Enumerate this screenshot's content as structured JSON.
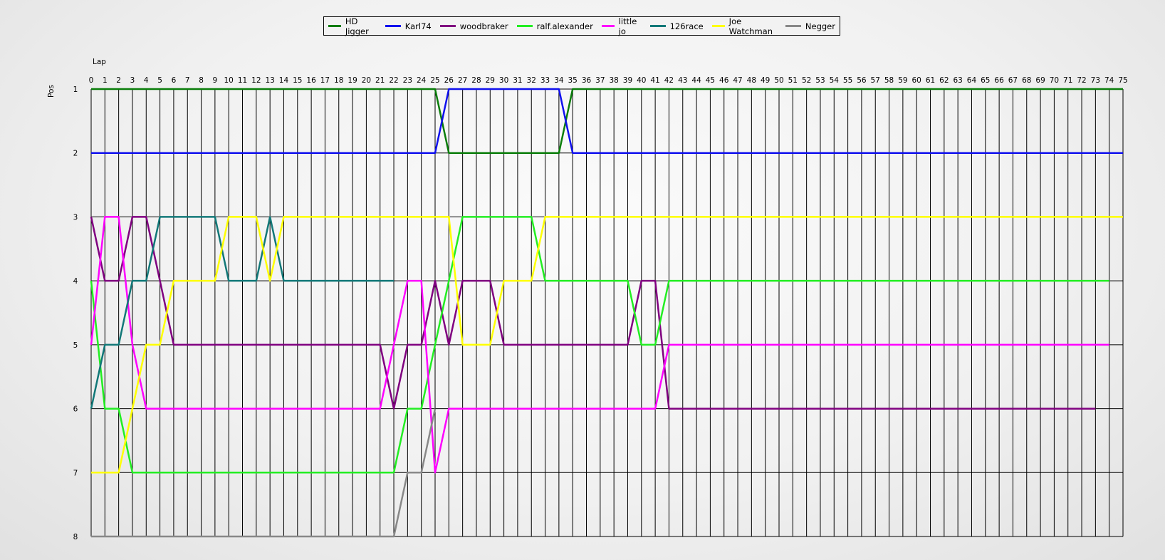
{
  "chart_data": {
    "type": "line",
    "xlabel": "Lap",
    "ylabel": "Pos",
    "xlim": [
      0,
      75
    ],
    "ylim": [
      1,
      8
    ],
    "y_inverted": true,
    "grid": true,
    "legend_position": "top-center",
    "x": [
      0,
      1,
      2,
      3,
      4,
      5,
      6,
      7,
      8,
      9,
      10,
      11,
      12,
      13,
      14,
      15,
      16,
      17,
      18,
      19,
      20,
      21,
      22,
      23,
      24,
      25,
      26,
      27,
      28,
      29,
      30,
      31,
      32,
      33,
      34,
      35,
      36,
      37,
      38,
      39,
      40,
      41,
      42,
      43,
      44,
      45,
      46,
      47,
      48,
      49,
      50,
      51,
      52,
      53,
      54,
      55,
      56,
      57,
      58,
      59,
      60,
      61,
      62,
      63,
      64,
      65,
      66,
      67,
      68,
      69,
      70,
      71,
      72,
      73,
      74,
      75
    ],
    "yticks": [
      1,
      2,
      3,
      4,
      5,
      6,
      7,
      8
    ],
    "series": [
      {
        "name": "HD Jigger",
        "color": "#0a7d0a",
        "values": [
          1,
          1,
          1,
          1,
          1,
          1,
          1,
          1,
          1,
          1,
          1,
          1,
          1,
          1,
          1,
          1,
          1,
          1,
          1,
          1,
          1,
          1,
          1,
          1,
          1,
          1,
          2,
          2,
          2,
          2,
          2,
          2,
          2,
          2,
          2,
          1,
          1,
          1,
          1,
          1,
          1,
          1,
          1,
          1,
          1,
          1,
          1,
          1,
          1,
          1,
          1,
          1,
          1,
          1,
          1,
          1,
          1,
          1,
          1,
          1,
          1,
          1,
          1,
          1,
          1,
          1,
          1,
          1,
          1,
          1,
          1,
          1,
          1,
          1,
          1,
          1
        ]
      },
      {
        "name": "Karl74",
        "color": "#1010ee",
        "values": [
          2,
          2,
          2,
          2,
          2,
          2,
          2,
          2,
          2,
          2,
          2,
          2,
          2,
          2,
          2,
          2,
          2,
          2,
          2,
          2,
          2,
          2,
          2,
          2,
          2,
          2,
          1,
          1,
          1,
          1,
          1,
          1,
          1,
          1,
          1,
          2,
          2,
          2,
          2,
          2,
          2,
          2,
          2,
          2,
          2,
          2,
          2,
          2,
          2,
          2,
          2,
          2,
          2,
          2,
          2,
          2,
          2,
          2,
          2,
          2,
          2,
          2,
          2,
          2,
          2,
          2,
          2,
          2,
          2,
          2,
          2,
          2,
          2,
          2,
          2,
          2
        ]
      },
      {
        "name": "woodbraker",
        "color": "#800080",
        "values": [
          3,
          4,
          4,
          3,
          3,
          4,
          5,
          5,
          5,
          5,
          5,
          5,
          5,
          5,
          5,
          5,
          5,
          5,
          5,
          5,
          5,
          5,
          6,
          5,
          5,
          4,
          5,
          4,
          4,
          4,
          5,
          5,
          5,
          5,
          5,
          5,
          5,
          5,
          5,
          5,
          4,
          4,
          6,
          6,
          6,
          6,
          6,
          6,
          6,
          6,
          6,
          6,
          6,
          6,
          6,
          6,
          6,
          6,
          6,
          6,
          6,
          6,
          6,
          6,
          6,
          6,
          6,
          6,
          6,
          6,
          6,
          6,
          6,
          6
        ]
      },
      {
        "name": "ralf.alexander",
        "color": "#22ee22",
        "values": [
          4,
          6,
          6,
          7,
          7,
          7,
          7,
          7,
          7,
          7,
          7,
          7,
          7,
          7,
          7,
          7,
          7,
          7,
          7,
          7,
          7,
          7,
          7,
          6,
          6,
          5,
          4,
          3,
          3,
          3,
          3,
          3,
          3,
          4,
          4,
          4,
          4,
          4,
          4,
          4,
          5,
          5,
          4,
          4,
          4,
          4,
          4,
          4,
          4,
          4,
          4,
          4,
          4,
          4,
          4,
          4,
          4,
          4,
          4,
          4,
          4,
          4,
          4,
          4,
          4,
          4,
          4,
          4,
          4,
          4,
          4,
          4,
          4,
          4,
          4
        ]
      },
      {
        "name": "little jo",
        "color": "#ff00ff",
        "values": [
          5,
          3,
          3,
          5,
          6,
          6,
          6,
          6,
          6,
          6,
          6,
          6,
          6,
          6,
          6,
          6,
          6,
          6,
          6,
          6,
          6,
          6,
          5,
          4,
          4,
          7,
          6,
          6,
          6,
          6,
          6,
          6,
          6,
          6,
          6,
          6,
          6,
          6,
          6,
          6,
          6,
          6,
          5,
          5,
          5,
          5,
          5,
          5,
          5,
          5,
          5,
          5,
          5,
          5,
          5,
          5,
          5,
          5,
          5,
          5,
          5,
          5,
          5,
          5,
          5,
          5,
          5,
          5,
          5,
          5,
          5,
          5,
          5,
          5,
          5
        ]
      },
      {
        "name": "126race",
        "color": "#127878",
        "values": [
          6,
          5,
          5,
          4,
          4,
          3,
          3,
          3,
          3,
          3,
          4,
          4,
          4,
          3,
          4,
          4,
          4,
          4,
          4,
          4,
          4,
          4,
          4
        ]
      },
      {
        "name": "Joe Watchman",
        "color": "#ffff00",
        "values": [
          7,
          7,
          7,
          6,
          5,
          5,
          4,
          4,
          4,
          4,
          3,
          3,
          3,
          4,
          3,
          3,
          3,
          3,
          3,
          3,
          3,
          3,
          3,
          3,
          3,
          3,
          3,
          5,
          5,
          5,
          4,
          4,
          4,
          3,
          3,
          3,
          3,
          3,
          3,
          3,
          3,
          3,
          3,
          3,
          3,
          3,
          3,
          3,
          3,
          3,
          3,
          3,
          3,
          3,
          3,
          3,
          3,
          3,
          3,
          3,
          3,
          3,
          3,
          3,
          3,
          3,
          3,
          3,
          3,
          3,
          3,
          3,
          3,
          3,
          3,
          3
        ]
      },
      {
        "name": "Negger",
        "color": "#888888",
        "values": [
          8,
          8,
          8,
          8,
          8,
          8,
          8,
          8,
          8,
          8,
          8,
          8,
          8,
          8,
          8,
          8,
          8,
          8,
          8,
          8,
          8,
          8,
          8,
          7,
          7,
          6
        ]
      }
    ]
  }
}
